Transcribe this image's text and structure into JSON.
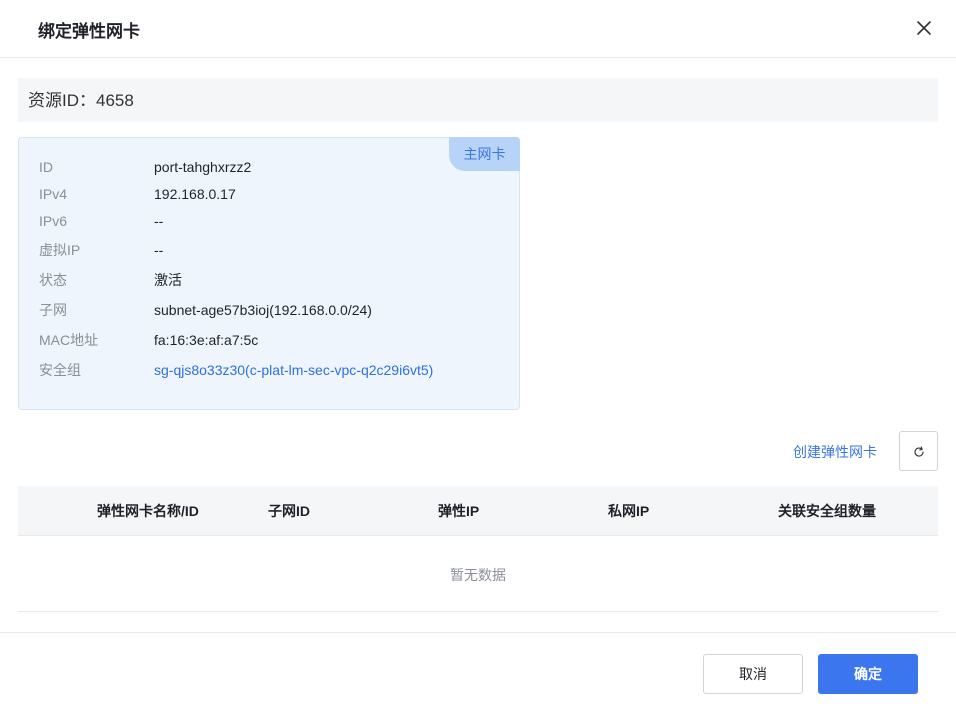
{
  "dialog": {
    "title": "绑定弹性网卡",
    "close_icon": "close-icon"
  },
  "resource": {
    "text": "资源ID：4658"
  },
  "card": {
    "badge": "主网卡",
    "rows": [
      {
        "key": "ID",
        "value": "port-tahghxrzz2"
      },
      {
        "key": "IPv4",
        "value": "192.168.0.17"
      },
      {
        "key": "IPv6",
        "value": "--"
      },
      {
        "key": "虚拟IP",
        "value": "--"
      },
      {
        "key": "状态",
        "value": "激活"
      },
      {
        "key": "子网",
        "value": "subnet-age57b3ioj(192.168.0.0/24)"
      },
      {
        "key": "MAC地址",
        "value": "fa:16:3e:af:a7:5c"
      },
      {
        "key": "安全组",
        "value": "sg-qjs8o33z30(c-plat-lm-sec-vpc-q2c29i6vt5)"
      }
    ]
  },
  "toolbar": {
    "create_label": "创建弹性网卡",
    "refresh_icon": "refresh-icon"
  },
  "table": {
    "columns": [
      "弹性网卡名称/ID",
      "子网ID",
      "弹性IP",
      "私网IP",
      "关联安全组数量"
    ],
    "empty_text": "暂无数据"
  },
  "footer": {
    "cancel_label": "取消",
    "ok_label": "确定"
  },
  "colors": {
    "primary": "#3b76ef",
    "link": "#2f6fdf",
    "card_bg": "#eef5fd",
    "badge_bg": "#b7d3f7"
  }
}
